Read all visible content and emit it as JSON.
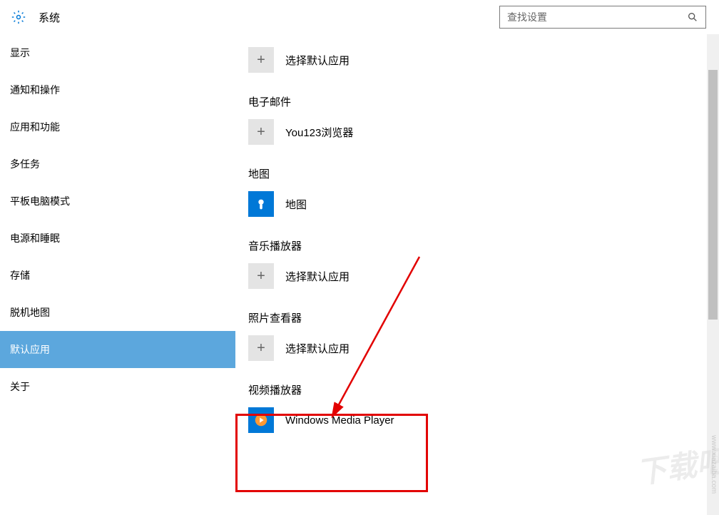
{
  "header": {
    "title": "系统",
    "search_placeholder": "查找设置"
  },
  "sidebar": {
    "items": [
      {
        "label": "显示",
        "selected": false
      },
      {
        "label": "通知和操作",
        "selected": false
      },
      {
        "label": "应用和功能",
        "selected": false
      },
      {
        "label": "多任务",
        "selected": false
      },
      {
        "label": "平板电脑模式",
        "selected": false
      },
      {
        "label": "电源和睡眠",
        "selected": false
      },
      {
        "label": "存储",
        "selected": false
      },
      {
        "label": "脱机地图",
        "selected": false
      },
      {
        "label": "默认应用",
        "selected": true
      },
      {
        "label": "关于",
        "selected": false
      }
    ]
  },
  "content": {
    "sections": [
      {
        "title": "",
        "app_label": "选择默认应用",
        "tile": "plus"
      },
      {
        "title": "电子邮件",
        "app_label": "You123浏览器",
        "tile": "plus"
      },
      {
        "title": "地图",
        "app_label": "地图",
        "tile": "maps"
      },
      {
        "title": "音乐播放器",
        "app_label": "选择默认应用",
        "tile": "plus"
      },
      {
        "title": "照片查看器",
        "app_label": "选择默认应用",
        "tile": "plus"
      },
      {
        "title": "视频播放器",
        "app_label": "Windows Media Player",
        "tile": "wmp"
      }
    ]
  },
  "watermark": {
    "text": "下载吧",
    "url": "www.xiazaiba.com"
  }
}
